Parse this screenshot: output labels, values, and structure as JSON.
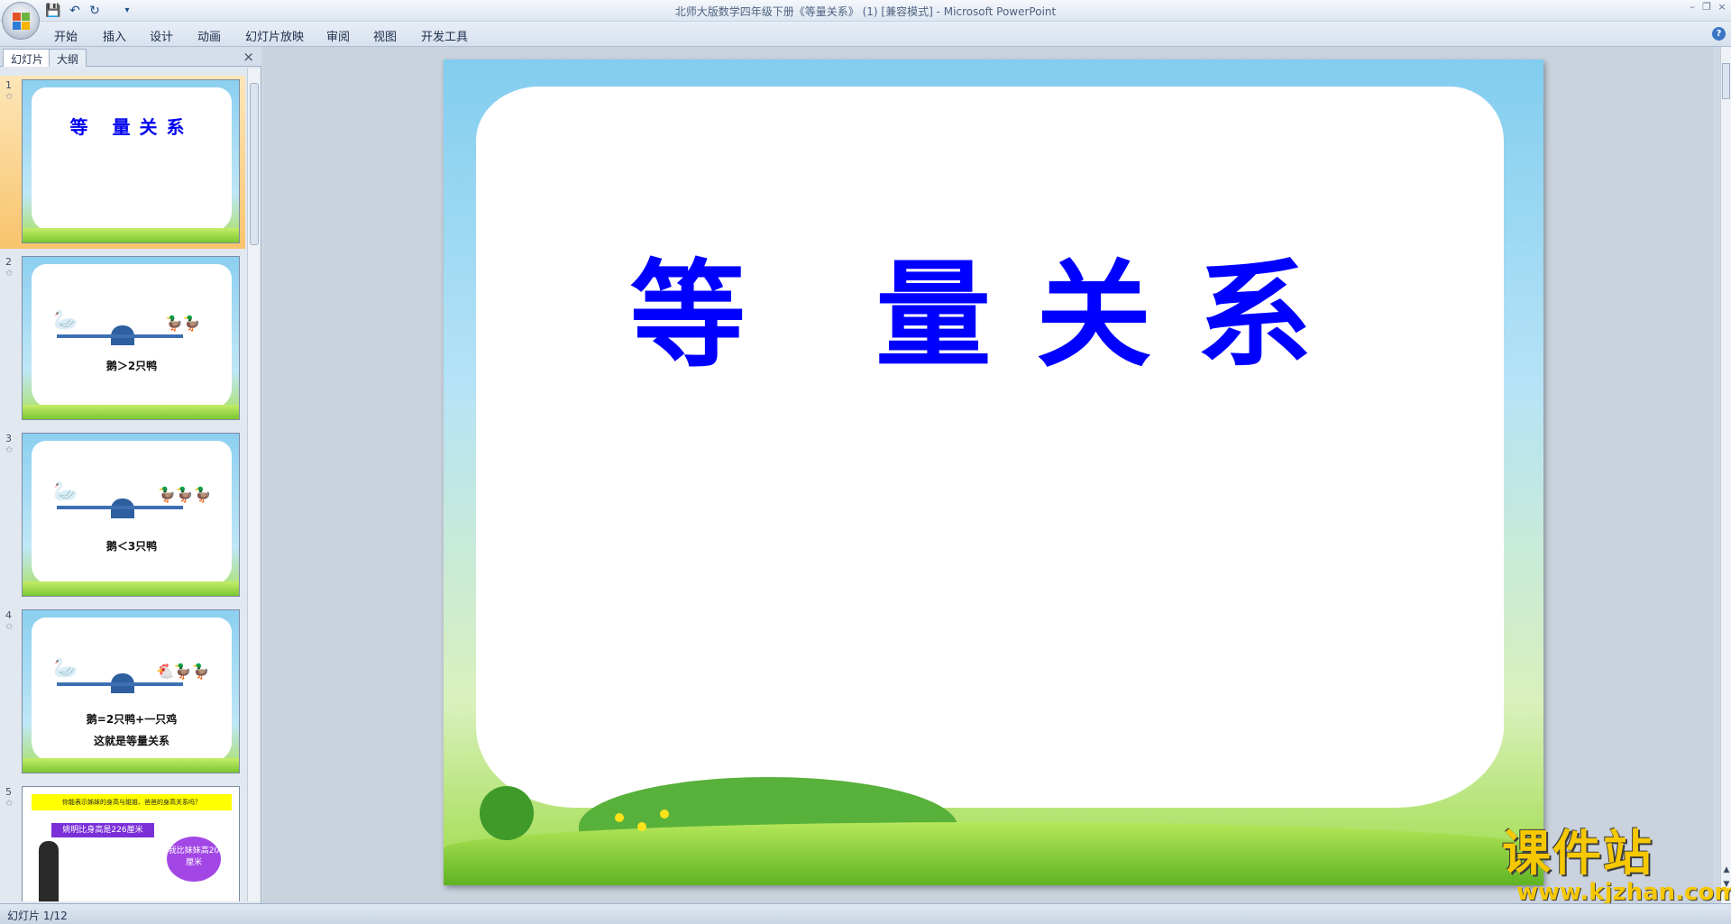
{
  "window": {
    "title": "北师大版数学四年级下册《等量关系》 (1) [兼容模式] - Microsoft PowerPoint",
    "controls": {
      "minimize": "–",
      "restore": "❐",
      "close": "×"
    }
  },
  "quick_access": {
    "save_icon": "save-icon",
    "undo_icon": "undo-icon",
    "redo_icon": "redo-icon",
    "more": "▾"
  },
  "ribbon": {
    "tabs": [
      "开始",
      "插入",
      "设计",
      "动画",
      "幻灯片放映",
      "审阅",
      "视图",
      "开发工具"
    ],
    "help": "?"
  },
  "pane": {
    "tab_slides": "幻灯片",
    "tab_outline": "大纲",
    "close": "×",
    "thumbnails": [
      {
        "number": "1",
        "title": "等 量关系",
        "selected": true
      },
      {
        "number": "2",
        "caption": "鹅＞2只鸭"
      },
      {
        "number": "3",
        "caption": "鹅＜3只鸭"
      },
      {
        "number": "4",
        "caption": "鹅=2只鸭+一只鸡",
        "caption2": "这就是等量关系"
      },
      {
        "number": "5",
        "banner": "你能表示姊妹的身高与姐姐、爸爸的身高关系吗？",
        "label": "姚明比身高是226厘米",
        "bubble": "我比妹妹高20厘米"
      }
    ]
  },
  "slide": {
    "title": "等 量关系"
  },
  "watermark": {
    "cn": "课件站",
    "url": "www.kjzhan.com"
  },
  "status": {
    "slide_indicator": "幻灯片 1/12"
  },
  "colors": {
    "title_blue": "#0000ff",
    "selected_thumb": "#f8c46c",
    "watermark_gold": "#f6c800"
  }
}
